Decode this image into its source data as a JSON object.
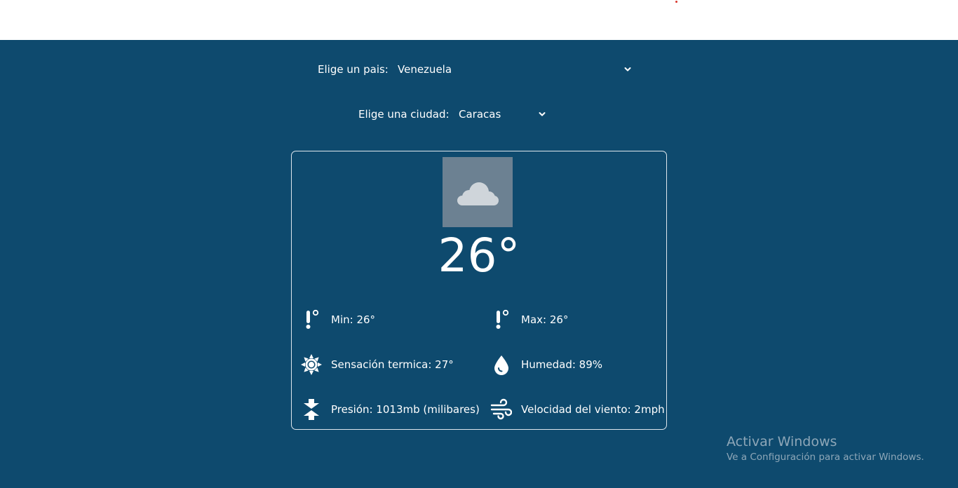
{
  "country_selector": {
    "label": "Elige un pais:",
    "selected": "Venezuela"
  },
  "city_selector": {
    "label": "Elige una ciudad:",
    "selected": "Caracas"
  },
  "weather": {
    "icon": "cloud-icon",
    "temperature": "26°",
    "stats": {
      "min": "Min: 26°",
      "max": "Max: 26°",
      "feels_like": "Sensación termica: 27°",
      "humidity": "Humedad: 89%",
      "pressure": "Presión: 1013mb (milibares)",
      "wind": "Velocidad del viento: 2mph"
    }
  },
  "watermark": {
    "title": "Activar Windows",
    "subtitle": "Ve a Configuración para activar Windows."
  },
  "colors": {
    "background": "#0e4a6e",
    "icon_box": "#6c8192",
    "text": "#ffffff"
  }
}
